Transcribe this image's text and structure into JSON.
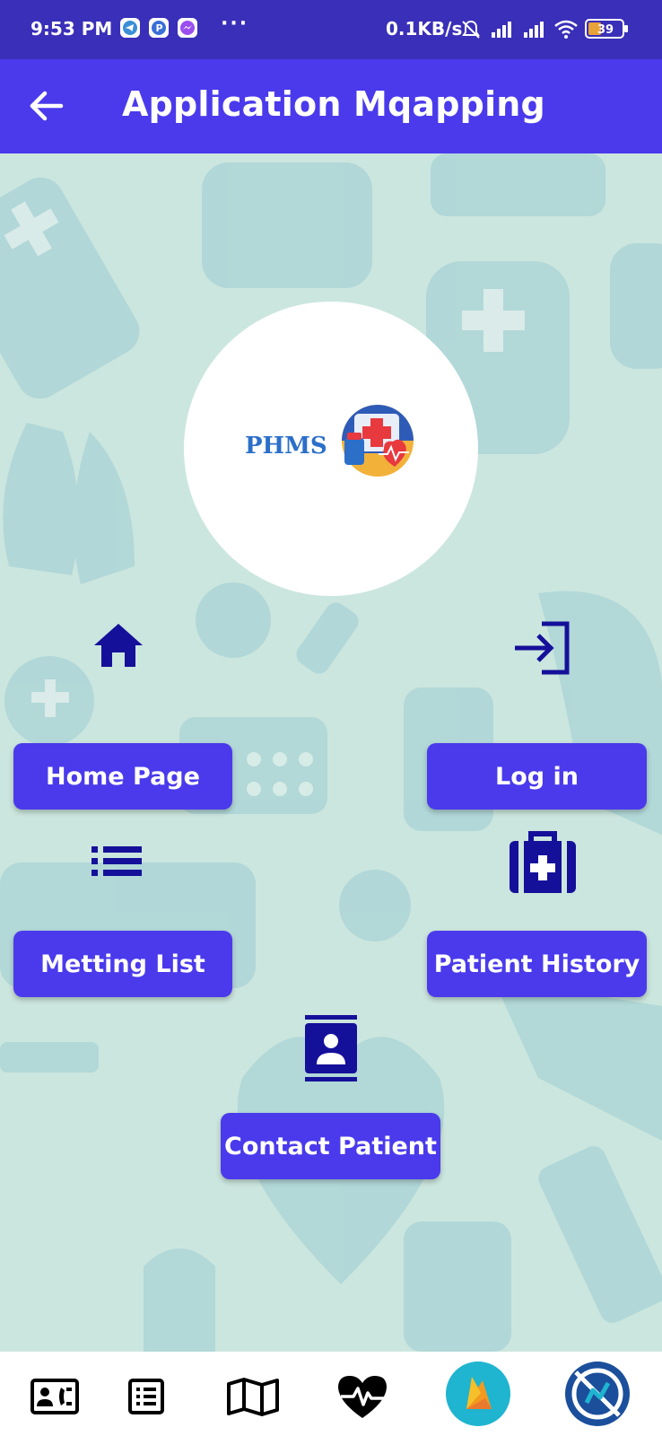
{
  "status_bar": {
    "time": "9:53 PM",
    "more_dots": "···",
    "net_speed": "0.1KB/s",
    "battery": "39",
    "bg_color": "#3a2fb8"
  },
  "app_bar": {
    "title": "Application Mqapping",
    "back_icon": "arrow-left-icon",
    "bg_color": "#4a3aec"
  },
  "logo": {
    "text": "PHMS",
    "emblem_icon": "medical-kit-heart-icon"
  },
  "menu": {
    "home": {
      "label": "Home Page",
      "icon": "home-icon"
    },
    "login": {
      "label": "Log in",
      "icon": "login-icon"
    },
    "meeting_list": {
      "label": "Metting List",
      "icon": "list-icon"
    },
    "patient_history": {
      "label": "Patient History",
      "icon": "medical-bag-icon"
    },
    "contact_patient": {
      "label": "Contact Patient",
      "icon": "contact-card-icon"
    },
    "button_color": "#4a3aec",
    "icon_color": "#15109a"
  },
  "bottom_nav": [
    {
      "icon": "contact-phone-icon"
    },
    {
      "icon": "list-alt-icon"
    },
    {
      "icon": "map-icon"
    },
    {
      "icon": "heart-pulse-icon"
    },
    {
      "icon": "firebase-icon"
    },
    {
      "icon": "analytics-logo-icon"
    }
  ]
}
